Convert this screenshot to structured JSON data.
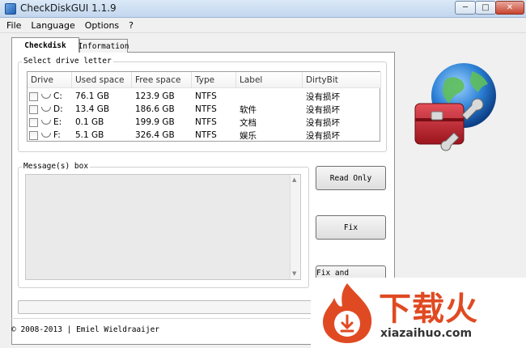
{
  "window": {
    "title": "CheckDiskGUI 1.1.9",
    "controls": {
      "minimize": "─",
      "maximize": "□",
      "close": "✕"
    }
  },
  "menu": [
    "File",
    "Language",
    "Options",
    "?"
  ],
  "tabs": [
    {
      "label": "Checkdisk",
      "active": true
    },
    {
      "label": "Information",
      "active": false
    }
  ],
  "drive_group": {
    "title": "Select drive letter",
    "columns": [
      "Drive",
      "Used space",
      "Free space",
      "Type",
      "Label",
      "DirtyBit"
    ],
    "rows": [
      {
        "drive": "C:",
        "used": "76.1 GB",
        "free": "123.9 GB",
        "type": "NTFS",
        "label": "",
        "dirty": "没有损坏"
      },
      {
        "drive": "D:",
        "used": "13.4 GB",
        "free": "186.6 GB",
        "type": "NTFS",
        "label": "软件",
        "dirty": "没有损坏"
      },
      {
        "drive": "E:",
        "used": "0.1 GB",
        "free": "199.9 GB",
        "type": "NTFS",
        "label": "文档",
        "dirty": "没有损坏"
      },
      {
        "drive": "F:",
        "used": "5.1 GB",
        "free": "326.4 GB",
        "type": "NTFS",
        "label": "娱乐",
        "dirty": "没有损坏"
      }
    ]
  },
  "message_group": {
    "title": "Message(s) box"
  },
  "buttons": {
    "read_only": "Read Only",
    "fix": "Fix",
    "fix_recover": "Fix and Recover"
  },
  "footer": {
    "copyright": "© 2008-2013 | Emiel Wieldraaijer"
  },
  "watermark": {
    "brand": "下载火",
    "url": "xiazaihuo.com"
  },
  "icons": {
    "app": "globe-toolbox-icon",
    "logo": "globe-toolbox-icon",
    "drive": "drive-icon"
  },
  "colors": {
    "accent": "#2a7fd4",
    "toolbox_red": "#c8202a",
    "watermark_orange": "#e04a22"
  }
}
